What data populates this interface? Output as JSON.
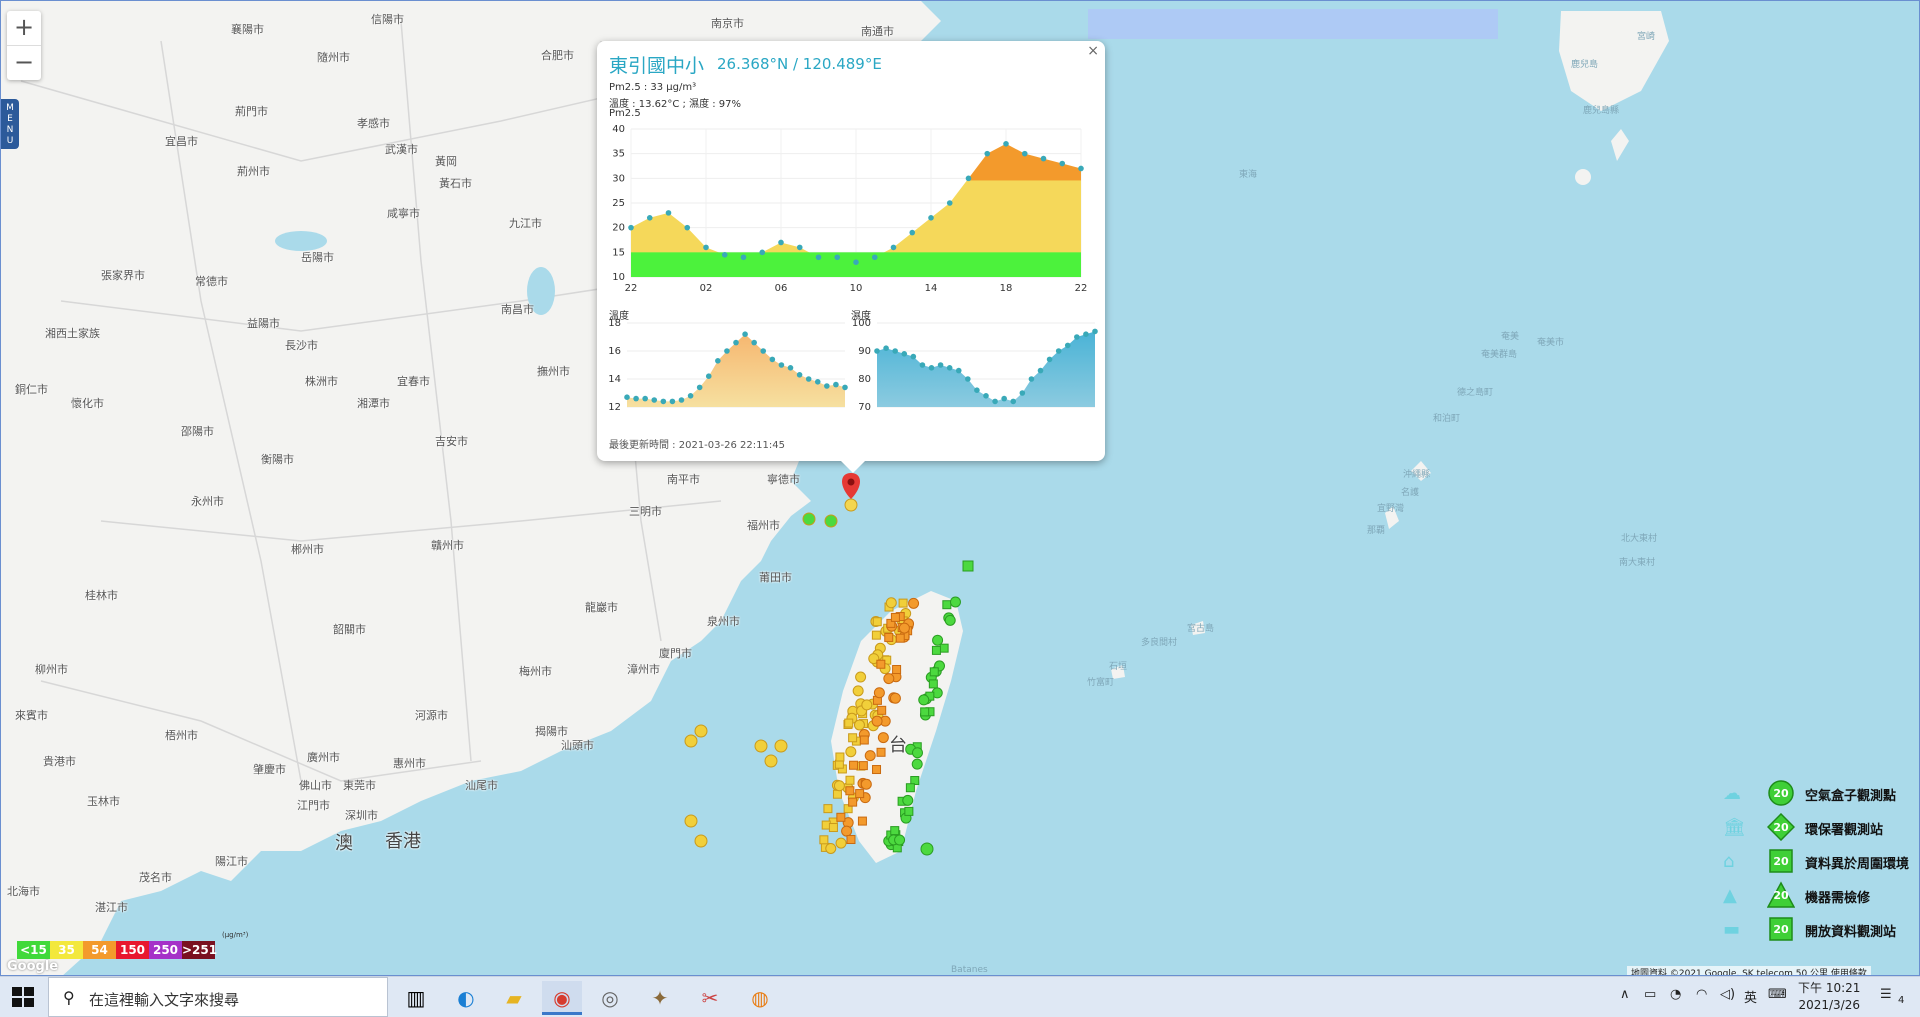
{
  "zoom": {
    "in_label": "+",
    "out_label": "−"
  },
  "menu_label": "M\nE\nN\nU",
  "map_labels": {
    "cities": [
      {
        "t": "襄陽市",
        "x": 230,
        "y": 20
      },
      {
        "t": "信陽市",
        "x": 370,
        "y": 10
      },
      {
        "t": "南京市",
        "x": 710,
        "y": 14
      },
      {
        "t": "南通市",
        "x": 860,
        "y": 22
      },
      {
        "t": "隨州市",
        "x": 316,
        "y": 48
      },
      {
        "t": "合肥市",
        "x": 540,
        "y": 46
      },
      {
        "t": "荊門市",
        "x": 234,
        "y": 102
      },
      {
        "t": "孝感市",
        "x": 356,
        "y": 114
      },
      {
        "t": "宜昌市",
        "x": 164,
        "y": 132
      },
      {
        "t": "武漢市",
        "x": 384,
        "y": 140
      },
      {
        "t": "黃岡",
        "x": 434,
        "y": 152
      },
      {
        "t": "荊州市",
        "x": 236,
        "y": 162
      },
      {
        "t": "黃石市",
        "x": 438,
        "y": 174
      },
      {
        "t": "咸寧市",
        "x": 386,
        "y": 204
      },
      {
        "t": "九江市",
        "x": 508,
        "y": 214
      },
      {
        "t": "張家界市",
        "x": 100,
        "y": 266
      },
      {
        "t": "常德市",
        "x": 194,
        "y": 272
      },
      {
        "t": "岳陽市",
        "x": 300,
        "y": 248
      },
      {
        "t": "南昌市",
        "x": 500,
        "y": 300
      },
      {
        "t": "益陽市",
        "x": 246,
        "y": 314
      },
      {
        "t": "湘西土家族",
        "x": 44,
        "y": 324
      },
      {
        "t": "長沙市",
        "x": 284,
        "y": 336
      },
      {
        "t": "株洲市",
        "x": 304,
        "y": 372
      },
      {
        "t": "宜春市",
        "x": 396,
        "y": 372
      },
      {
        "t": "撫州市",
        "x": 536,
        "y": 362
      },
      {
        "t": "懷化市",
        "x": 70,
        "y": 394
      },
      {
        "t": "銅仁市",
        "x": 14,
        "y": 380
      },
      {
        "t": "湘潭市",
        "x": 356,
        "y": 394
      },
      {
        "t": "邵陽市",
        "x": 180,
        "y": 422
      },
      {
        "t": "吉安市",
        "x": 434,
        "y": 432
      },
      {
        "t": "衡陽市",
        "x": 260,
        "y": 450
      },
      {
        "t": "南平市",
        "x": 666,
        "y": 470
      },
      {
        "t": "寧德市",
        "x": 766,
        "y": 470
      },
      {
        "t": "永州市",
        "x": 190,
        "y": 492
      },
      {
        "t": "三明市",
        "x": 628,
        "y": 502
      },
      {
        "t": "福州市",
        "x": 746,
        "y": 516
      },
      {
        "t": "郴州市",
        "x": 290,
        "y": 540
      },
      {
        "t": "贛州市",
        "x": 430,
        "y": 536
      },
      {
        "t": "莆田市",
        "x": 758,
        "y": 568
      },
      {
        "t": "桂林市",
        "x": 84,
        "y": 586
      },
      {
        "t": "龍巖市",
        "x": 584,
        "y": 598
      },
      {
        "t": "泉州市",
        "x": 706,
        "y": 612
      },
      {
        "t": "韶關市",
        "x": 332,
        "y": 620
      },
      {
        "t": "廈門市",
        "x": 658,
        "y": 644
      },
      {
        "t": "漳州市",
        "x": 626,
        "y": 660
      },
      {
        "t": "柳州市",
        "x": 34,
        "y": 660
      },
      {
        "t": "梅州市",
        "x": 518,
        "y": 662
      },
      {
        "t": "河源市",
        "x": 414,
        "y": 706
      },
      {
        "t": "來賓市",
        "x": 14,
        "y": 706
      },
      {
        "t": "揭陽市",
        "x": 534,
        "y": 722
      },
      {
        "t": "汕頭市",
        "x": 560,
        "y": 736
      },
      {
        "t": "梧州市",
        "x": 164,
        "y": 726
      },
      {
        "t": "廣州市",
        "x": 306,
        "y": 748
      },
      {
        "t": "惠州市",
        "x": 392,
        "y": 754
      },
      {
        "t": "肇慶市",
        "x": 252,
        "y": 760
      },
      {
        "t": "佛山市",
        "x": 298,
        "y": 776
      },
      {
        "t": "東莞市",
        "x": 342,
        "y": 776
      },
      {
        "t": "汕尾市",
        "x": 464,
        "y": 776
      },
      {
        "t": "貴港市",
        "x": 42,
        "y": 752
      },
      {
        "t": "玉林市",
        "x": 86,
        "y": 792
      },
      {
        "t": "江門市",
        "x": 296,
        "y": 796
      },
      {
        "t": "深圳市",
        "x": 344,
        "y": 806
      },
      {
        "t": "陽江市",
        "x": 214,
        "y": 852
      },
      {
        "t": "茂名市",
        "x": 138,
        "y": 868
      },
      {
        "t": "北海市",
        "x": 6,
        "y": 882
      },
      {
        "t": "湛江市",
        "x": 94,
        "y": 898
      }
    ],
    "big": [
      {
        "t": "香港",
        "x": 384,
        "y": 826
      },
      {
        "t": "澳",
        "x": 334,
        "y": 828
      },
      {
        "t": "台",
        "x": 888,
        "y": 730
      }
    ],
    "sea": [
      {
        "t": "宮崎",
        "x": 1636,
        "y": 28
      },
      {
        "t": "鹿兒島",
        "x": 1570,
        "y": 56
      },
      {
        "t": "鹿兒島縣",
        "x": 1582,
        "y": 102
      },
      {
        "t": "東海",
        "x": 1238,
        "y": 166
      },
      {
        "t": "奄美",
        "x": 1500,
        "y": 328
      },
      {
        "t": "奄美市",
        "x": 1536,
        "y": 334
      },
      {
        "t": "奄美群島",
        "x": 1480,
        "y": 346
      },
      {
        "t": "德之島町",
        "x": 1456,
        "y": 384
      },
      {
        "t": "和泊町",
        "x": 1432,
        "y": 410
      },
      {
        "t": "沖繩縣",
        "x": 1402,
        "y": 466
      },
      {
        "t": "名護",
        "x": 1400,
        "y": 484
      },
      {
        "t": "宜野灣",
        "x": 1376,
        "y": 500
      },
      {
        "t": "那覇",
        "x": 1366,
        "y": 522
      },
      {
        "t": "北大東村",
        "x": 1620,
        "y": 530
      },
      {
        "t": "南大東村",
        "x": 1618,
        "y": 554
      },
      {
        "t": "宮古島",
        "x": 1186,
        "y": 620
      },
      {
        "t": "多良間村",
        "x": 1140,
        "y": 634
      },
      {
        "t": "石垣",
        "x": 1108,
        "y": 658
      },
      {
        "t": "竹富町",
        "x": 1086,
        "y": 674
      },
      {
        "t": "Batanes",
        "x": 950,
        "y": 964
      }
    ]
  },
  "popup": {
    "close": "×",
    "title": "東引國中小",
    "coords": "26.368°N / 120.489°E",
    "pm25_line": "Pm2.5 : 33 μg/m³",
    "temp_hum_line": "溫度 : 13.62°C ; 濕度 : 97%",
    "chart_title": "Pm2.5",
    "temp_label": "溫度",
    "hum_label": "濕度",
    "updated": "最後更新時間 : 2021-03-26 22:11:45"
  },
  "chart_data": [
    {
      "type": "area",
      "title": "Pm2.5",
      "categories": [
        "22",
        "02",
        "06",
        "10",
        "14",
        "18",
        "22"
      ],
      "x": [
        0,
        1,
        2,
        3,
        4,
        5,
        6,
        7,
        8,
        9,
        10,
        11,
        12,
        13,
        14,
        15,
        16,
        17,
        18,
        19,
        20,
        21,
        22,
        23,
        24
      ],
      "values": [
        20,
        22,
        23,
        20,
        16,
        14.5,
        14,
        15,
        17,
        16,
        14,
        14,
        13,
        14,
        16,
        19,
        22,
        25,
        30,
        35,
        37,
        35,
        34,
        33,
        32
      ],
      "yticks": [
        10,
        15,
        20,
        25,
        30,
        35,
        40
      ],
      "ylim": [
        10,
        40
      ]
    },
    {
      "type": "area",
      "title": "溫度",
      "x": [
        0,
        1,
        2,
        3,
        4,
        5,
        6,
        7,
        8,
        9,
        10,
        11,
        12,
        13,
        14,
        15,
        16,
        17,
        18,
        19,
        20,
        21,
        22,
        23,
        24
      ],
      "values": [
        12.7,
        12.6,
        12.6,
        12.5,
        12.4,
        12.4,
        12.5,
        12.8,
        13.4,
        14.2,
        15.3,
        16.0,
        16.6,
        17.2,
        16.6,
        16.0,
        15.4,
        15.0,
        14.8,
        14.3,
        14.0,
        13.8,
        13.5,
        13.6,
        13.4
      ],
      "yticks": [
        12,
        14,
        16,
        18
      ],
      "ylim": [
        12,
        18
      ]
    },
    {
      "type": "area",
      "title": "濕度",
      "x": [
        0,
        1,
        2,
        3,
        4,
        5,
        6,
        7,
        8,
        9,
        10,
        11,
        12,
        13,
        14,
        15,
        16,
        17,
        18,
        19,
        20,
        21,
        22,
        23,
        24
      ],
      "values": [
        90,
        91,
        90,
        89,
        88,
        85,
        84,
        85,
        84,
        83,
        80,
        76,
        74,
        72,
        73,
        72,
        75,
        80,
        83,
        87,
        90,
        92,
        95,
        96,
        97
      ],
      "yticks": [
        70,
        80,
        90,
        100
      ],
      "ylim": [
        70,
        100
      ]
    }
  ],
  "legend": [
    {
      "label": "空氣盒子觀測點",
      "num": "20",
      "shape": "circle",
      "icon": "cloud-box-icon",
      "icon_glyph": "☁"
    },
    {
      "label": "環保署觀測站",
      "num": "20",
      "shape": "diamond",
      "icon": "building-icon",
      "icon_glyph": "🏛"
    },
    {
      "label": "資料異於周圍環境",
      "num": "20",
      "shape": "square",
      "icon": "house-icon",
      "icon_glyph": "⌂"
    },
    {
      "label": "機器需檢修",
      "num": "20",
      "shape": "triangle",
      "icon": "tower-icon",
      "icon_glyph": "▲"
    },
    {
      "label": "開放資料觀測站",
      "num": "20",
      "shape": "square",
      "icon": "open-data-icon",
      "icon_glyph": "▬"
    }
  ],
  "scale": {
    "unit": "(μg/m³)",
    "items": [
      {
        "t": "<15",
        "c": "#40d93a"
      },
      {
        "t": "35",
        "c": "#f3e83c"
      },
      {
        "t": "54",
        "c": "#f39a2c"
      },
      {
        "t": "150",
        "c": "#e8172e"
      },
      {
        "t": "250",
        "c": "#a532c8"
      },
      {
        "t": ">251",
        "c": "#7a1020"
      }
    ]
  },
  "google": "Google",
  "attribution": "地圖資料 ©2021 Google, SK telecom   50 公里   使用條款",
  "taskbar": {
    "search_placeholder": "在這裡輸入文字來搜尋",
    "ime": "英",
    "time": "下午 10:21",
    "date": "2021/3/26",
    "notify_count": "4"
  },
  "colors": {
    "sea": "#aadaea",
    "land": "#f3f3f1",
    "accent": "#2aa7c4",
    "pin": "#e53935"
  }
}
